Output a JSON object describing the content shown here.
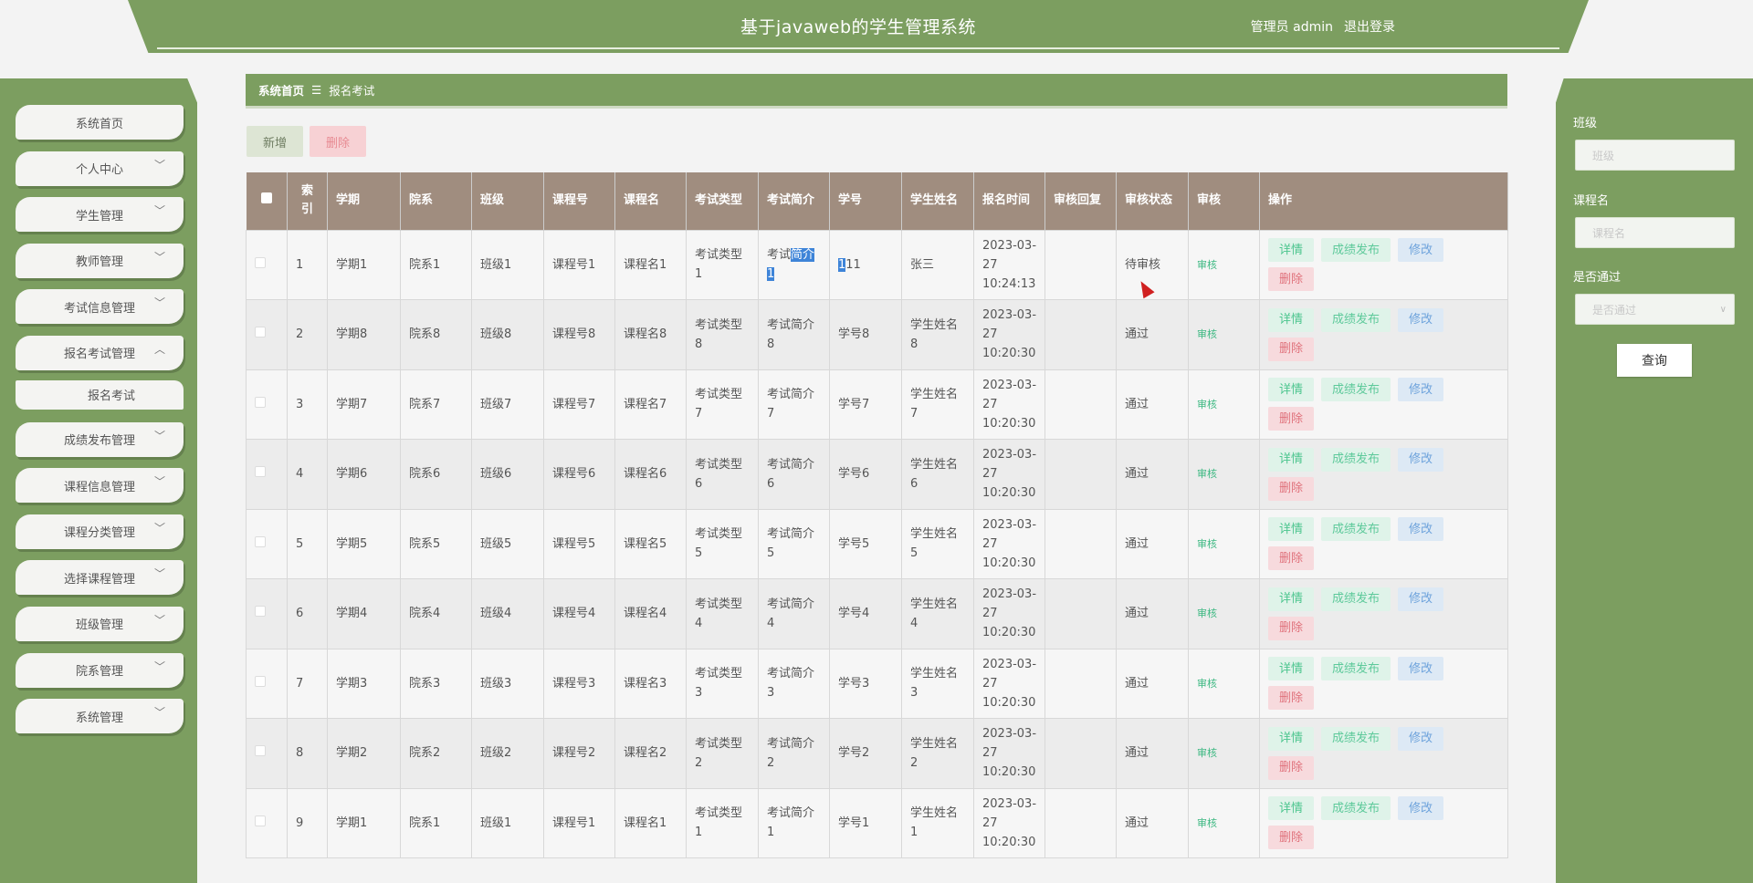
{
  "header": {
    "title": "基于javaweb的学生管理系统",
    "user_label": "管理员 admin",
    "logout": "退出登录"
  },
  "sidebar": {
    "items": [
      {
        "label": "系统首页",
        "chevron": false
      },
      {
        "label": "个人中心",
        "chevron": true
      },
      {
        "label": "学生管理",
        "chevron": true
      },
      {
        "label": "教师管理",
        "chevron": true
      },
      {
        "label": "考试信息管理",
        "chevron": true
      },
      {
        "label": "报名考试管理",
        "chevron": true,
        "expanded": true
      }
    ],
    "sub_item": "报名考试",
    "items_after": [
      {
        "label": "成绩发布管理"
      },
      {
        "label": "课程信息管理"
      },
      {
        "label": "课程分类管理"
      },
      {
        "label": "选择课程管理"
      },
      {
        "label": "班级管理"
      },
      {
        "label": "院系管理"
      },
      {
        "label": "系统管理"
      }
    ]
  },
  "breadcrumb": {
    "home": "系统首页",
    "separator": "☰",
    "current": "报名考试"
  },
  "actions": {
    "add": "新增",
    "delete": "删除"
  },
  "search": {
    "class_label": "班级",
    "class_placeholder": "班级",
    "course_label": "课程名",
    "course_placeholder": "课程名",
    "pass_label": "是否通过",
    "pass_placeholder": "是否通过",
    "submit": "查询"
  },
  "table": {
    "headers": [
      "索引",
      "学期",
      "院系",
      "班级",
      "课程号",
      "课程名",
      "考试类型",
      "考试简介",
      "学号",
      "学生姓名",
      "报名时间",
      "审核回复",
      "审核状态",
      "审核",
      "操作"
    ],
    "audit_label": "审核",
    "op_labels": {
      "detail": "详情",
      "publish": "成绩发布",
      "edit": "修改",
      "delete": "删除"
    },
    "rows": [
      {
        "idx": "1",
        "term": "学期1",
        "dept": "院系1",
        "cls": "班级1",
        "cno": "课程号1",
        "cname": "课程名1",
        "etype": "考试类型1",
        "eintro_a": "考试",
        "eintro_b": "简介1",
        "sno_a": "1",
        "sno_b": "11",
        "sname": "张三",
        "time": "2023-03-27 10:24:13",
        "reply": "",
        "status": "待审核"
      },
      {
        "idx": "2",
        "term": "学期8",
        "dept": "院系8",
        "cls": "班级8",
        "cno": "课程号8",
        "cname": "课程名8",
        "etype": "考试类型8",
        "eintro": "考试简介8",
        "sno": "学号8",
        "sname": "学生姓名8",
        "time": "2023-03-27 10:20:30",
        "reply": "",
        "status": "通过"
      },
      {
        "idx": "3",
        "term": "学期7",
        "dept": "院系7",
        "cls": "班级7",
        "cno": "课程号7",
        "cname": "课程名7",
        "etype": "考试类型7",
        "eintro": "考试简介7",
        "sno": "学号7",
        "sname": "学生姓名7",
        "time": "2023-03-27 10:20:30",
        "reply": "",
        "status": "通过"
      },
      {
        "idx": "4",
        "term": "学期6",
        "dept": "院系6",
        "cls": "班级6",
        "cno": "课程号6",
        "cname": "课程名6",
        "etype": "考试类型6",
        "eintro": "考试简介6",
        "sno": "学号6",
        "sname": "学生姓名6",
        "time": "2023-03-27 10:20:30",
        "reply": "",
        "status": "通过"
      },
      {
        "idx": "5",
        "term": "学期5",
        "dept": "院系5",
        "cls": "班级5",
        "cno": "课程号5",
        "cname": "课程名5",
        "etype": "考试类型5",
        "eintro": "考试简介5",
        "sno": "学号5",
        "sname": "学生姓名5",
        "time": "2023-03-27 10:20:30",
        "reply": "",
        "status": "通过"
      },
      {
        "idx": "6",
        "term": "学期4",
        "dept": "院系4",
        "cls": "班级4",
        "cno": "课程号4",
        "cname": "课程名4",
        "etype": "考试类型4",
        "eintro": "考试简介4",
        "sno": "学号4",
        "sname": "学生姓名4",
        "time": "2023-03-27 10:20:30",
        "reply": "",
        "status": "通过"
      },
      {
        "idx": "7",
        "term": "学期3",
        "dept": "院系3",
        "cls": "班级3",
        "cno": "课程号3",
        "cname": "课程名3",
        "etype": "考试类型3",
        "eintro": "考试简介3",
        "sno": "学号3",
        "sname": "学生姓名3",
        "time": "2023-03-27 10:20:30",
        "reply": "",
        "status": "通过"
      },
      {
        "idx": "8",
        "term": "学期2",
        "dept": "院系2",
        "cls": "班级2",
        "cno": "课程号2",
        "cname": "课程名2",
        "etype": "考试类型2",
        "eintro": "考试简介2",
        "sno": "学号2",
        "sname": "学生姓名2",
        "time": "2023-03-27 10:20:30",
        "reply": "",
        "status": "通过"
      },
      {
        "idx": "9",
        "term": "学期1",
        "dept": "院系1",
        "cls": "班级1",
        "cno": "课程号1",
        "cname": "课程名1",
        "etype": "考试类型1",
        "eintro": "考试简介1",
        "sno": "学号1",
        "sname": "学生姓名1",
        "time": "2023-03-27 10:20:30",
        "reply": "",
        "status": "通过"
      }
    ]
  },
  "colors": {
    "primary_green": "#7c9e60",
    "table_header": "#a08d7f",
    "selection": "#3e84d8"
  }
}
